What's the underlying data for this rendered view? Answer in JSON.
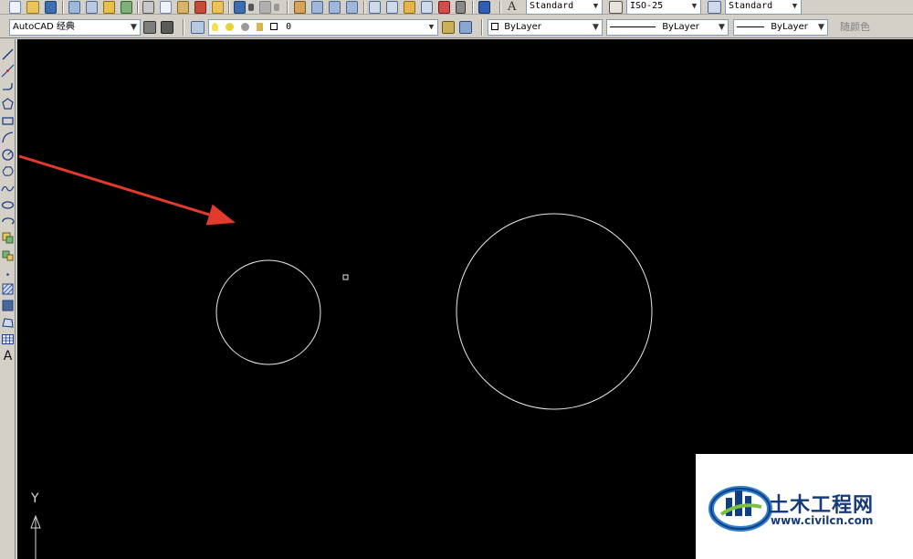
{
  "toolbar_top": {
    "text_style": "Standard",
    "dim_style": "ISO-25",
    "table_style": "Standard"
  },
  "toolbar_second": {
    "workspace": "AutoCAD 经典",
    "layer": "0",
    "color": "ByLayer",
    "linetype": "ByLayer",
    "lineweight": "ByLayer",
    "plot_style": "随颜色"
  },
  "left_toolbar": {
    "text_tool_label": "A"
  },
  "canvas": {
    "background": "#000000",
    "ucs_y_label": "Y",
    "arrow_color": "#e23b2e"
  },
  "watermark": {
    "name": "土木工程网",
    "url": "www.civilcn.com"
  }
}
